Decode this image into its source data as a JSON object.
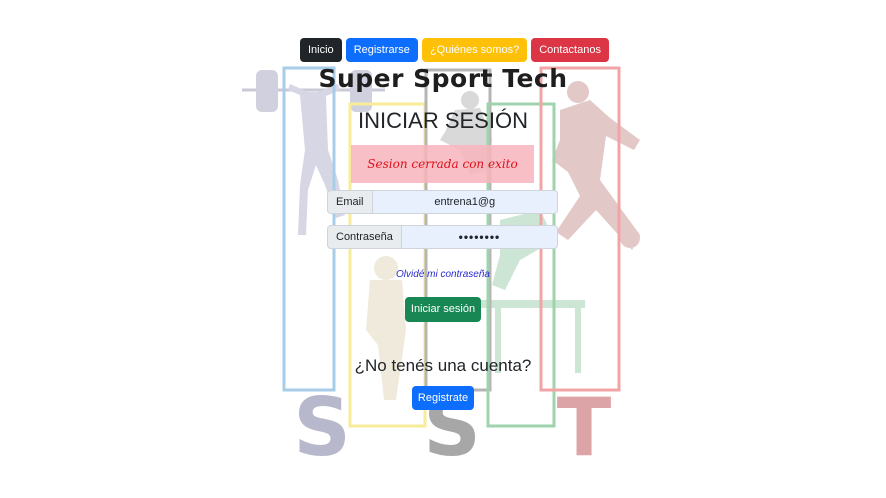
{
  "nav": {
    "items": [
      {
        "label": "Inicio",
        "style": "dark"
      },
      {
        "label": "Registrarse",
        "style": "blue"
      },
      {
        "label": "¿Quiénes somos?",
        "style": "yellow"
      },
      {
        "label": "Contactanos",
        "style": "red"
      }
    ]
  },
  "brand": {
    "title": "Super Sport Tech"
  },
  "login": {
    "heading": "INICIAR SESIÓN",
    "alert": "Sesion cerrada con exito",
    "email_label": "Email",
    "email_value": "entrena1@g",
    "password_label": "Contraseña",
    "password_value": "••••••••",
    "forgot_link": "Olvidé mi contraseña",
    "submit_label": "Iniciar sesión"
  },
  "register": {
    "prompt": "¿No tenés una cuenta?",
    "button_label": "Registrate"
  },
  "background": {
    "letters": [
      "S",
      "S",
      "T"
    ],
    "colors": {
      "blue": "#a8cde8",
      "yellow": "#f6ec9a",
      "gray": "#9a9a9a",
      "green": "#9ed3ae",
      "red": "#f1a4a6"
    }
  }
}
